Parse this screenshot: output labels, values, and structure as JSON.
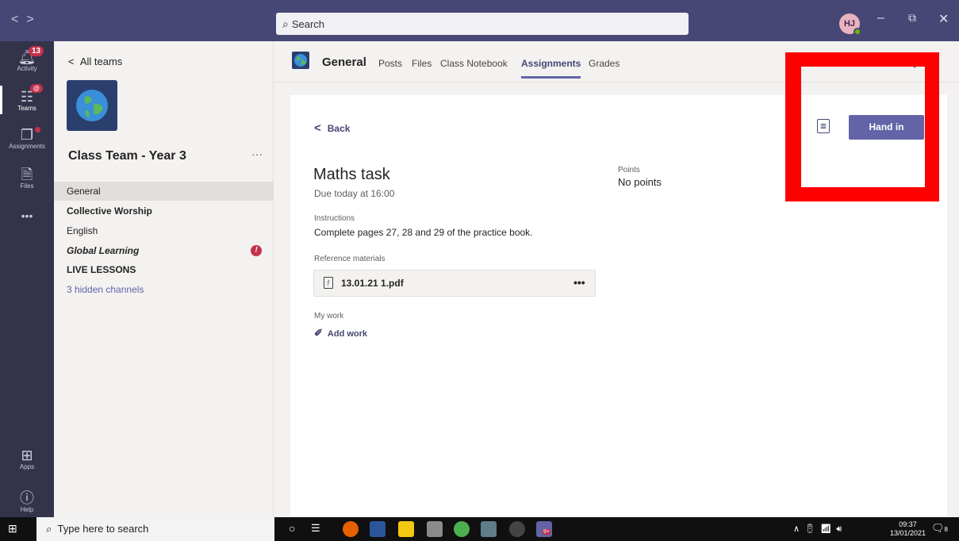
{
  "titlebar": {
    "search_placeholder": "Search",
    "avatar_initials": "HJ"
  },
  "rail": {
    "activity": {
      "label": "Activity",
      "badge": "13"
    },
    "teams": {
      "label": "Teams"
    },
    "assignments": {
      "label": "Assignments"
    },
    "files": {
      "label": "Files"
    },
    "more": "•••",
    "apps": {
      "label": "Apps"
    },
    "help": {
      "label": "Help"
    }
  },
  "team_panel": {
    "all_teams": "All teams",
    "team_name": "Class Team - Year 3",
    "more": "···",
    "channels": [
      {
        "label": "General"
      },
      {
        "label": "Collective Worship"
      },
      {
        "label": "English"
      },
      {
        "label": "Global Learning",
        "badge": "!"
      },
      {
        "label": "LIVE LESSONS"
      },
      {
        "label": "3 hidden channels"
      }
    ]
  },
  "channel_header": {
    "title": "General",
    "tabs": [
      "Posts",
      "Files",
      "Class Notebook",
      "Assignments",
      "Grades"
    ]
  },
  "assignment": {
    "back_label": "Back",
    "title": "Maths task",
    "due": "Due today at 16:00",
    "points_label": "Points",
    "points_value": "No points",
    "instructions_label": "Instructions",
    "instructions_text": "Complete pages 27, 28 and 29 of the practice book.",
    "reference_label": "Reference materials",
    "file_name": "13.01.21 1.pdf",
    "file_more": "•••",
    "my_work_label": "My work",
    "add_work_label": "Add work",
    "hand_in_label": "Hand in"
  },
  "taskbar": {
    "search_placeholder": "Type here to search",
    "time": "09:37",
    "date": "13/01/2021",
    "notification_count": "8",
    "teams_badge": "9+"
  }
}
